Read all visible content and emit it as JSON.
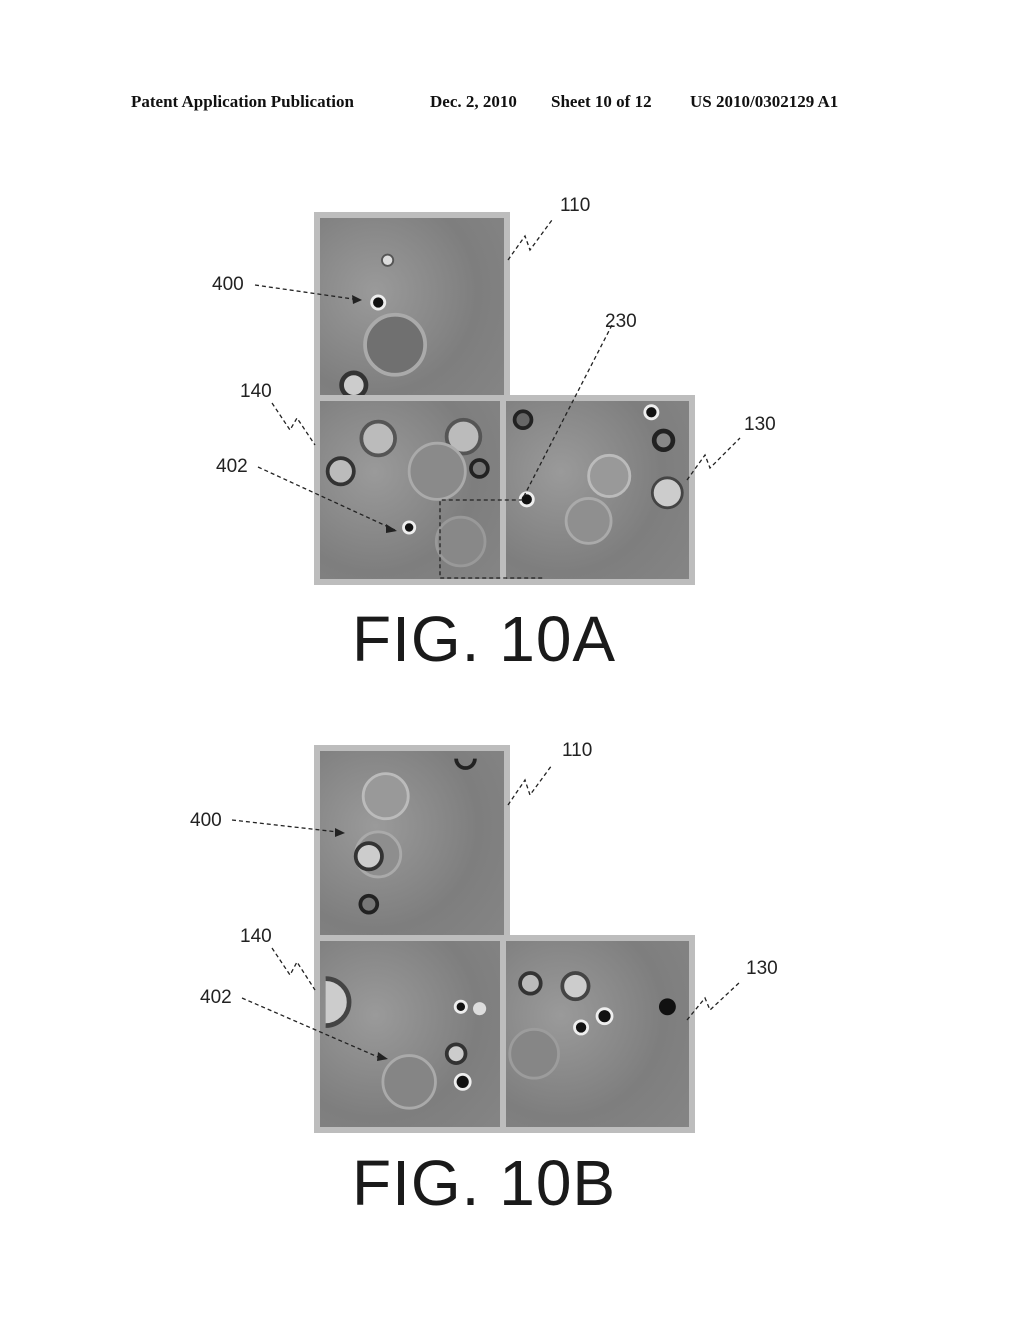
{
  "header": {
    "publication": "Patent Application Publication",
    "date": "Dec. 2, 2010",
    "sheet": "Sheet 10 of 12",
    "number": "US 2010/0302129 A1"
  },
  "figures": [
    {
      "caption": "FIG. 10A",
      "labels": {
        "tile_top": "110",
        "tile_left": "140",
        "tile_right": "130",
        "cell_a": "400",
        "cell_b": "402",
        "region": "230"
      }
    },
    {
      "caption": "FIG. 10B",
      "labels": {
        "tile_top": "110",
        "tile_left": "140",
        "tile_right": "130",
        "cell_a": "400",
        "cell_b": "402"
      }
    }
  ]
}
